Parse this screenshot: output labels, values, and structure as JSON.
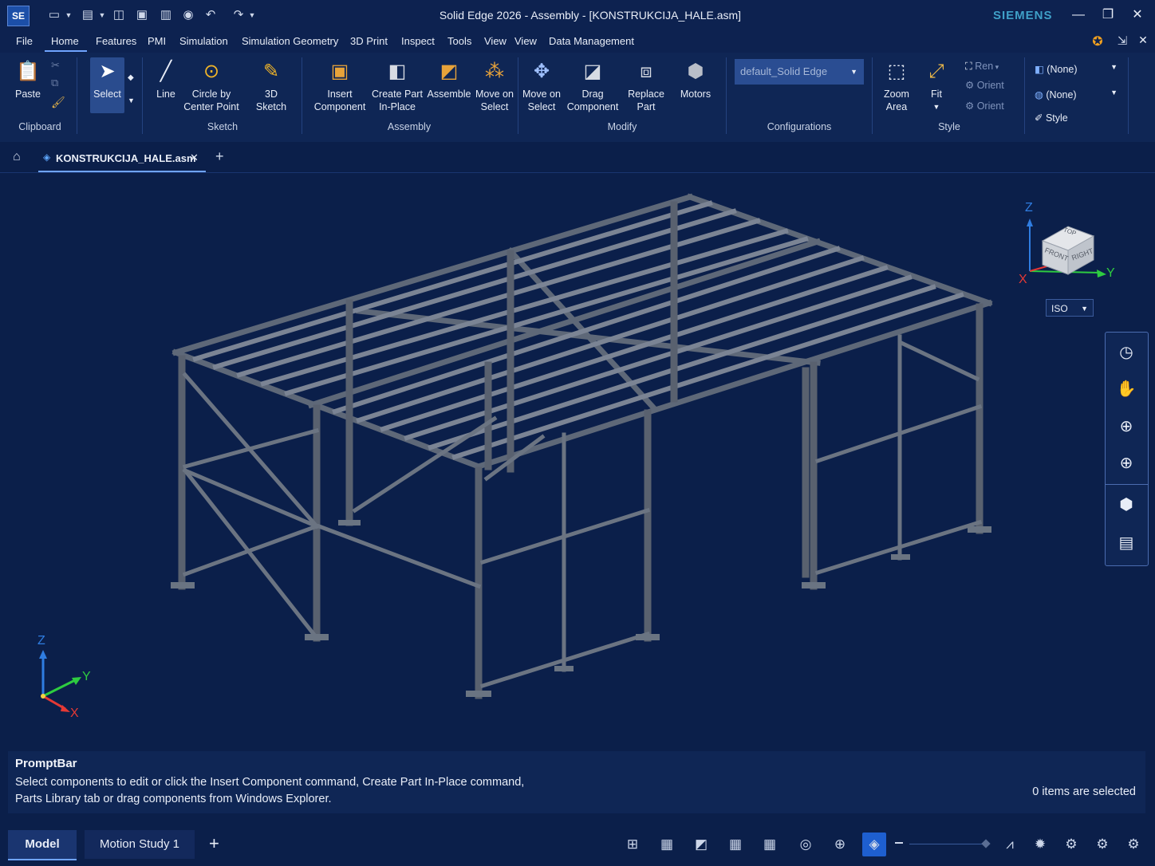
{
  "app": {
    "logo": "SE",
    "title": "Solid Edge 2026 - Assembly - [KONSTRUKCIJA_HALE.asm]",
    "brand": "SIEMENS"
  },
  "quick_access": [
    "new-icon",
    "open-icon",
    "save-icon",
    "print-icon",
    "properties-icon",
    "web-icon",
    "undo-icon",
    "redo-icon"
  ],
  "menu": {
    "items": [
      "File",
      "Home",
      "Features",
      "PMI",
      "Simulation",
      "Simulation Geometry",
      "3D Print",
      "Inspect",
      "Tools",
      "View",
      "View",
      "Data Management"
    ],
    "active": "Home"
  },
  "ribbon": {
    "clipboard": {
      "paste": "Paste",
      "group": "Clipboard"
    },
    "select": {
      "label": "Select"
    },
    "sketch": {
      "line": "Line",
      "circle_l1": "Circle by",
      "circle_l2": "Center Point",
      "sketch3d_l1": "3D",
      "sketch3d_l2": "Sketch",
      "group": "Sketch"
    },
    "assembly": {
      "insert_l1": "Insert",
      "insert_l2": "Component",
      "create_l1": "Create Part",
      "create_l2": "In-Place",
      "assemble": "Assemble",
      "move_l1": "Move on",
      "move_l2": "Select",
      "group": "Assembly"
    },
    "modify": {
      "move_l1": "Move on",
      "move_l2": "Select",
      "drag_l1": "Drag",
      "drag_l2": "Component",
      "replace_l1": "Replace",
      "replace_l2": "Part",
      "motors": "Motors",
      "group": "Modify"
    },
    "configurations": {
      "value": "default_Solid Edge",
      "group": "Configurations"
    },
    "style": {
      "zoom_l1": "Zoom",
      "zoom_l2": "Area",
      "fit": "Fit",
      "rend": "Ren",
      "orient1": "Orient",
      "orient2": "Orient",
      "group": "Style"
    },
    "appearance": {
      "combo1": "(None)",
      "combo2": "(None)",
      "style": "Style"
    }
  },
  "document_tab": {
    "name": "KONSTRUKCIJA_HALE.asm"
  },
  "viewport": {
    "view_orientation": "ISO",
    "cube_faces": {
      "top": "TOP",
      "front": "FRONT",
      "right": "RIGHT"
    },
    "axes": {
      "z": "Z",
      "y": "Y",
      "x": "X"
    },
    "side_tools": [
      "history-icon",
      "pan-hand-icon",
      "zoom-in-icon",
      "zoom-icon",
      "view-cube-icon",
      "panel-icon"
    ],
    "colors": {
      "background": "#0b1f4a",
      "axis_x": "#e53935",
      "axis_y": "#2ecc40",
      "axis_z": "#2f7de1"
    }
  },
  "promptbar": {
    "title": "PromptBar",
    "line1": "Select components to edit or click the Insert Component command, Create Part In-Place command,",
    "line2": "Parts Library tab or drag components from Windows Explorer.",
    "status": "0 items are selected"
  },
  "bottom": {
    "tabs": [
      "Model",
      "Motion Study 1"
    ],
    "add": "+"
  }
}
